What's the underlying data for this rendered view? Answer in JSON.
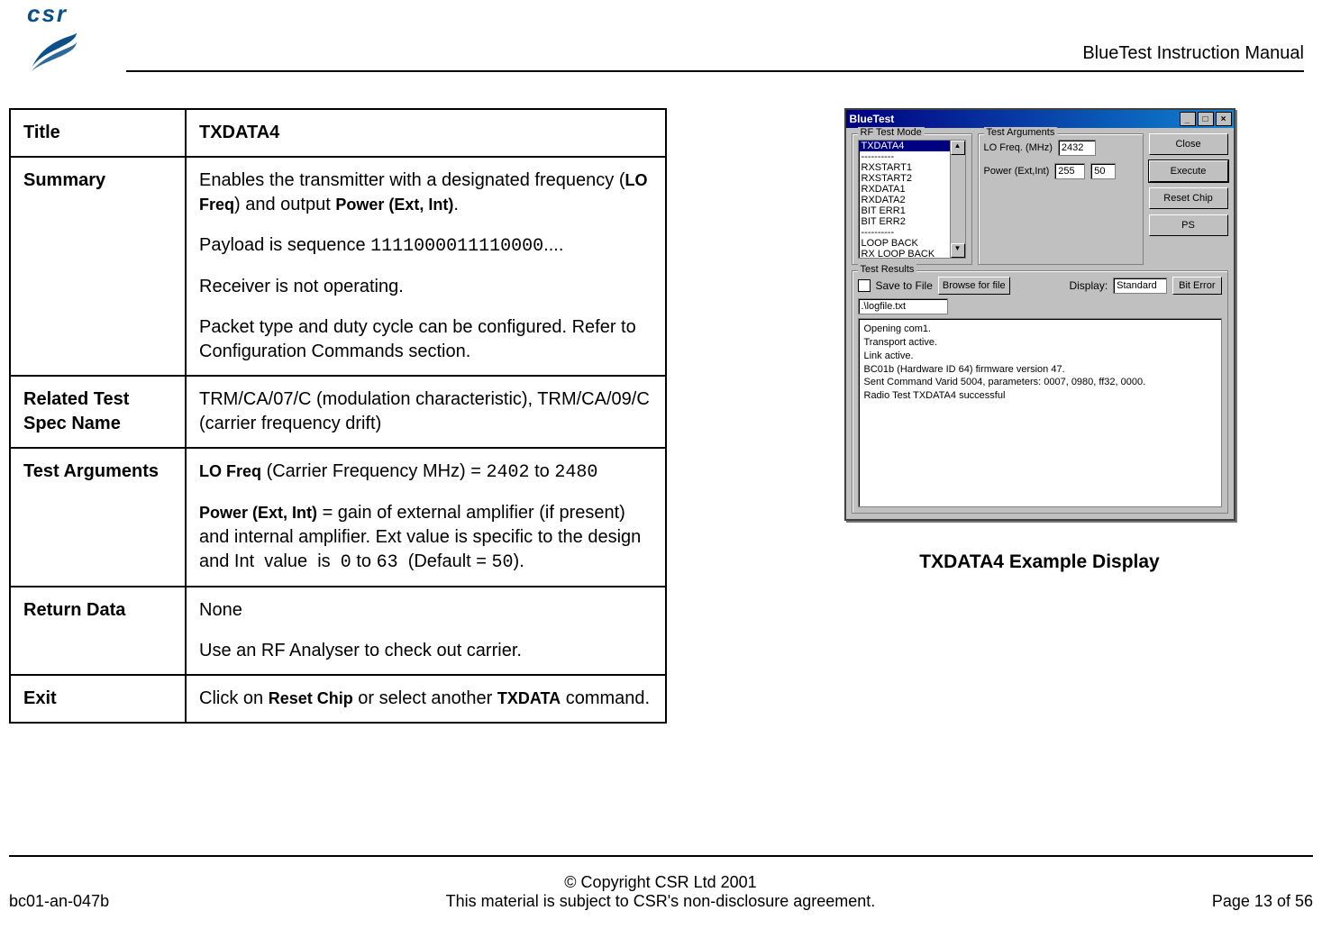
{
  "header": {
    "logo_text": "csr",
    "title": "BlueTest Instruction Manual"
  },
  "table": {
    "rows": [
      {
        "key": "Title",
        "value_html": "<b>TXDATA4</b>"
      },
      {
        "key": "Summary",
        "value_html": "<p class='para'>Enables the transmitter with a designated frequency (<span class='smallbold'>LO Freq</span>) and output <span class='smallbold'>Power (Ext, Int)</span>.</p><p class='para'>Payload is sequence <span class='code'>1111000011110000</span>....</p><p class='para'>Receiver is not operating.</p><p class='para'>Packet type and duty cycle can be configured. Refer to Configuration Commands section.</p>"
      },
      {
        "key": "Related Test Spec Name",
        "value_html": "TRM/CA/07/C (modulation characteristic), TRM/CA/09/C (carrier frequency drift)"
      },
      {
        "key": "Test Arguments",
        "value_html": "<p class='para'><span class='smallbold'>LO Freq</span> (Carrier Frequency MHz) = <span class='code'>2402</span> to <span class='code'>2480</span></p><p class='para'><span class='smallbold'>Power (Ext, Int)</span> = gain of external amplifier (if present) and internal amplifier. Ext value is specific to the design and Int&nbsp; value&nbsp; is&nbsp; <span class='code'>0</span> to <span class='code'>63</span>&nbsp; (Default = <span class='code'>50</span>).</p>"
      },
      {
        "key": "Return Data",
        "value_html": "<p class='para'>None</p><p class='para'>Use an RF Analyser to check out carrier.</p>"
      },
      {
        "key": "Exit",
        "value_html": "Click on <span class='smallbold'>Reset Chip</span> or select another <span class='smallbold'>TXDATA</span> command."
      }
    ]
  },
  "dialog": {
    "title": "BlueTest",
    "groups": {
      "rf_mode": "RF Test Mode",
      "args": "Test Arguments",
      "results": "Test Results"
    },
    "list_items": [
      {
        "text": "TXDATA4",
        "selected": true
      },
      {
        "text": "----------",
        "selected": false
      },
      {
        "text": "RXSTART1",
        "selected": false
      },
      {
        "text": "RXSTART2",
        "selected": false
      },
      {
        "text": "RXDATA1",
        "selected": false
      },
      {
        "text": "RXDATA2",
        "selected": false
      },
      {
        "text": "BIT ERR1",
        "selected": false
      },
      {
        "text": "BIT ERR2",
        "selected": false
      },
      {
        "text": "----------",
        "selected": false
      },
      {
        "text": "LOOP BACK",
        "selected": false
      },
      {
        "text": "RX LOOP BACK",
        "selected": false
      }
    ],
    "args": {
      "lofreq_label": "LO Freq. (MHz)",
      "lofreq_value": "2432",
      "power_label": "Power (Ext,Int)",
      "power_ext": "255",
      "power_int": "50"
    },
    "buttons": {
      "close": "Close",
      "execute": "Execute",
      "reset": "Reset Chip",
      "ps": "PS",
      "browse": "Browse for file",
      "biterror": "Bit Error"
    },
    "results": {
      "save_label": "Save to File",
      "display_label": "Display:",
      "display_value": "Standard",
      "filepath": ".\\logfile.txt",
      "log": "Opening com1.\nTransport active.\nLink active.\nBC01b (Hardware ID 64) firmware version 47.\nSent Command Varid 5004, parameters: 0007, 0980, ff32, 0000.\nRadio Test TXDATA4 successful"
    }
  },
  "caption": "TXDATA4 Example Display",
  "footer": {
    "left": "bc01-an-047b",
    "center1": "© Copyright CSR Ltd 2001",
    "center2": "This material is subject to CSR's non-disclosure agreement.",
    "right": "Page 13 of 56"
  }
}
